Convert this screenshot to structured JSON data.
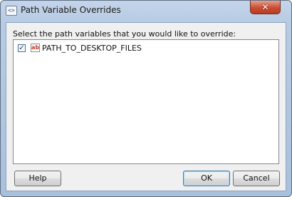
{
  "window": {
    "title": "Path Variable Overrides",
    "icon": "code-brackets-icon",
    "close_glyph": "✕"
  },
  "dialog": {
    "prompt": "Select the path variables that you would like to override:",
    "items": [
      {
        "label": "PATH_TO_DESKTOP_FILES",
        "checked": true,
        "icon": "ab-variable-icon",
        "icon_text": "ab"
      }
    ]
  },
  "buttons": {
    "help": "Help",
    "ok": "OK",
    "cancel": "Cancel"
  },
  "colors": {
    "title_bar": "#b7cbe4",
    "close_button": "#c94d32",
    "client_background": "#f0f0f0",
    "default_button_border": "#3c7fb1"
  }
}
